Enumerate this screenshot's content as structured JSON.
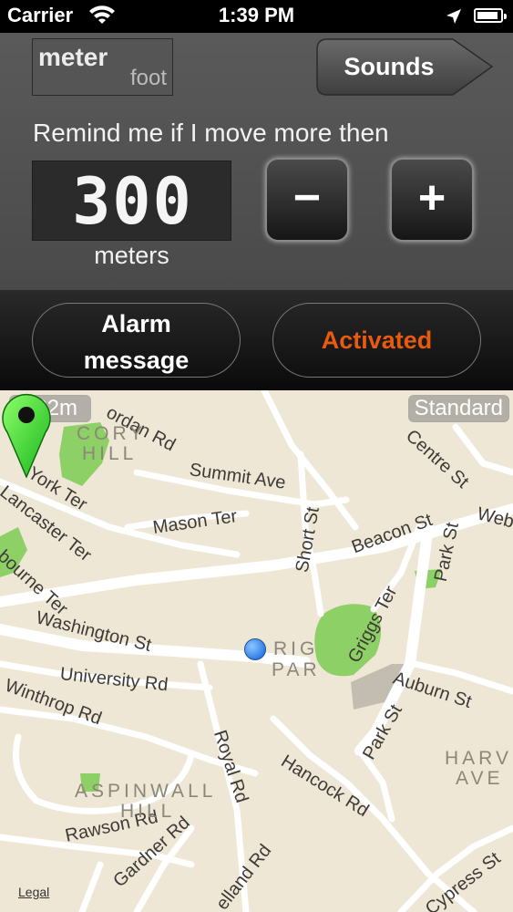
{
  "status_bar": {
    "carrier": "Carrier",
    "time": "1:39 PM"
  },
  "settings": {
    "unit_primary": "meter",
    "unit_secondary": "foot",
    "sounds_label": "Sounds",
    "remind_text": "Remind me if I move more then",
    "distance_value": "300",
    "distance_unit": "meters",
    "decrement_label": "−",
    "increment_label": "+"
  },
  "actions": {
    "alarm_line1": "Alarm",
    "alarm_line2": "message",
    "activated_label": "Activated",
    "activated_color": "#e85a10"
  },
  "map": {
    "scale_label": "222m",
    "map_type": "Standard",
    "legal": "Legal",
    "streets": [
      "ordan Rd",
      "Summit Ave",
      "York Ter",
      "Lancaster Ter",
      "Mason Ter",
      "Short St",
      "Beacon St",
      "Centre St",
      "Webs",
      "Park St",
      "bourne Ter",
      "Washington St",
      "University Rd",
      "Winthrop Rd",
      "Griggs Ter",
      "Auburn St",
      "Royal Rd",
      "Hancock Rd",
      "Park St",
      "Rawson Rd",
      "Gardner Rd",
      "elland Rd",
      "Cypress St"
    ],
    "districts": [
      "CORY",
      "HILL",
      "RIG",
      "PAR",
      "HARV",
      "AVE",
      "ASPINWALL",
      "HILL"
    ],
    "park_color": "#8dd066"
  }
}
